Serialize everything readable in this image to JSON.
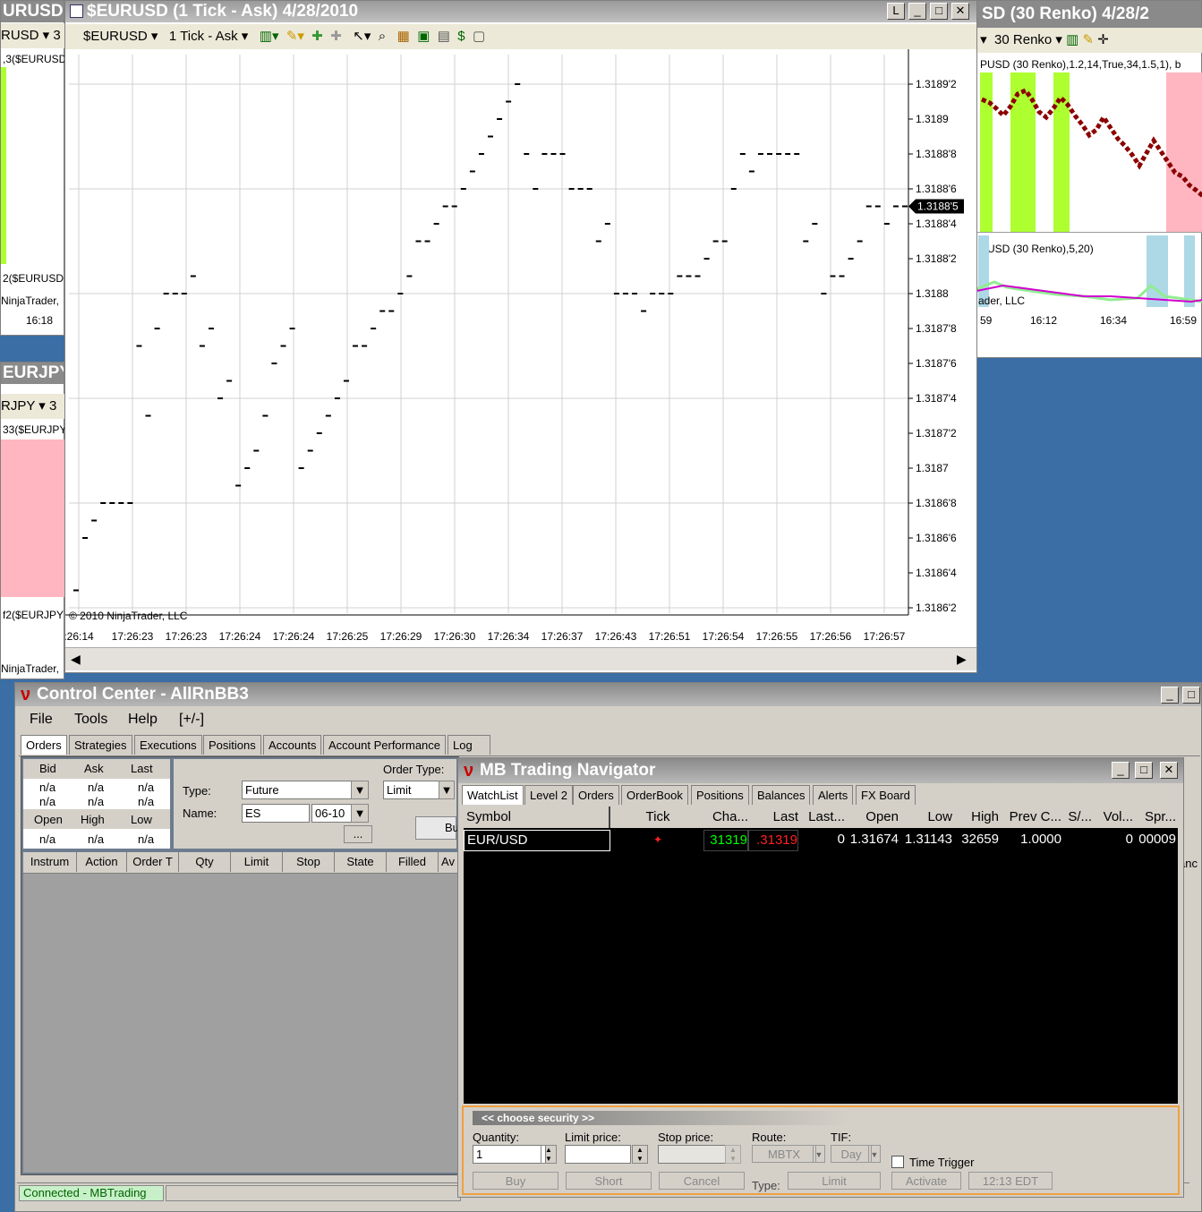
{
  "left_windows": {
    "top_title": "URUSD",
    "top_toolbar": "RUSD",
    "top_toolbar_right": "3",
    "top_indicator": ",3($EURUSD",
    "top_indicator2": "2($EURUSD",
    "top_footer": "NinjaTrader,",
    "top_time": "16:18",
    "bottom_title": "EURJPY",
    "bottom_toolbar": "RJPY",
    "bottom_toolbar_right": "3",
    "bottom_indicator": "33($EURJPY",
    "bottom_indicator2": "f2($EURJPY",
    "bottom_footer": "NinjaTrader,"
  },
  "renko_window": {
    "title": "SD (30 Renko)  4/28/2",
    "toolbar_label": "30 Renko",
    "indicator_label": "PUSD  (30  Renko),1.2,14,True,34,1.5,1),",
    "indicator_suffix": "b",
    "indicator2_label": "PUSD  (30 Renko),5,20)",
    "footer": "ader, LLC",
    "times": [
      "59",
      "16:12",
      "16:34",
      "16:59"
    ]
  },
  "tick_chart": {
    "title": "$EURUSD (1 Tick - Ask)  4/28/2010",
    "toolbar": {
      "instrument": "$EURUSD",
      "period": "1 Tick - Ask"
    },
    "copyright": "© 2010 NinjaTrader, LLC",
    "current_price": "1.3188'5",
    "chart_data": {
      "type": "scatter",
      "xlabel": "",
      "ylabel": "",
      "x_ticks": [
        ":26:14",
        "17:26:23",
        "17:26:23",
        "17:26:24",
        "17:26:24",
        "17:26:25",
        "17:26:29",
        "17:26:30",
        "17:26:34",
        "17:26:37",
        "17:26:43",
        "17:26:51",
        "17:26:54",
        "17:26:55",
        "17:26:56",
        "17:26:57"
      ],
      "y_ticks": [
        "1.3189'2",
        "1.3189",
        "1.3188'8",
        "1.3188'6",
        "1.3188'4",
        "1.3188'2",
        "1.3188",
        "1.3187'8",
        "1.3187'6",
        "1.3187'4",
        "1.3187'2",
        "1.3187",
        "1.3186'8",
        "1.3186'6",
        "1.3186'4",
        "1.3186'2"
      ],
      "ylim": [
        1.31862,
        1.31892
      ],
      "values": [
        1.31863,
        1.31866,
        1.31867,
        1.31868,
        1.31868,
        1.31868,
        1.31868,
        1.31877,
        1.31873,
        1.31878,
        1.3188,
        1.3188,
        1.3188,
        1.31881,
        1.31877,
        1.31878,
        1.31874,
        1.31875,
        1.31869,
        1.3187,
        1.31871,
        1.31873,
        1.31876,
        1.31877,
        1.31878,
        1.3187,
        1.31871,
        1.31872,
        1.31873,
        1.31874,
        1.31875,
        1.31877,
        1.31877,
        1.31878,
        1.31879,
        1.31879,
        1.3188,
        1.31881,
        1.31883,
        1.31883,
        1.31884,
        1.31885,
        1.31885,
        1.31886,
        1.31887,
        1.31888,
        1.31889,
        1.3189,
        1.31891,
        1.31892,
        1.31888,
        1.31886,
        1.31888,
        1.31888,
        1.31888,
        1.31886,
        1.31886,
        1.31886,
        1.31883,
        1.31884,
        1.3188,
        1.3188,
        1.3188,
        1.31879,
        1.3188,
        1.3188,
        1.3188,
        1.31881,
        1.31881,
        1.31881,
        1.31882,
        1.31883,
        1.31883,
        1.31886,
        1.31888,
        1.31887,
        1.31888,
        1.31888,
        1.31888,
        1.31888,
        1.31888,
        1.31883,
        1.31884,
        1.3188,
        1.31881,
        1.31881,
        1.31882,
        1.31883,
        1.31885,
        1.31885,
        1.31884,
        1.31885,
        1.31885
      ]
    }
  },
  "control_center": {
    "title": "Control Center - AllRnBB3",
    "menu": [
      "File",
      "Tools",
      "Help",
      "[+/-]"
    ],
    "tabs": [
      "Orders",
      "Strategies",
      "Executions",
      "Positions",
      "Accounts",
      "Account Performance",
      "Log"
    ],
    "quote_headers": [
      "Bid",
      "Ask",
      "Last"
    ],
    "quote_row1": [
      "n/a",
      "n/a",
      "n/a"
    ],
    "quote_row2": [
      "n/a",
      "n/a",
      "n/a"
    ],
    "quote_headers2": [
      "Open",
      "High",
      "Low"
    ],
    "quote_row3": [
      "n/a",
      "n/a",
      "n/a"
    ],
    "type_label": "Type:",
    "type_value": "Future",
    "name_label": "Name:",
    "name_value": "ES",
    "expiry_value": "06-10",
    "order_type_label": "Order Type:",
    "order_type_value": "Limit",
    "buy_partial": "Bu",
    "ellipsis": "...",
    "grid_headers": [
      "Instrum",
      "Action",
      "Order T",
      "Qty",
      "Limit",
      "Stop",
      "State",
      "Filled",
      "Av"
    ],
    "status": "Connected - MBTrading",
    "edge_text": "anc"
  },
  "navigator": {
    "title": "MB Trading Navigator",
    "tabs": [
      "WatchList",
      "Level 2",
      "Orders",
      "OrderBook",
      "Positions",
      "Balances",
      "Alerts",
      "FX Board"
    ],
    "headers": [
      "Symbol",
      "Tick",
      "Cha...",
      "Last",
      "Last...",
      "Open",
      "Low",
      "High",
      "Prev C...",
      "S/...",
      "Vol...",
      "Spr..."
    ],
    "row": {
      "symbol": "EUR/USD",
      "change": "31319",
      "last": ".31319",
      "last_size": "0",
      "open": "1.31674",
      "low": "1.31143",
      "high": "32659",
      "prev_close": "1.0000",
      "s": "",
      "volume": "0",
      "spread": "00009"
    },
    "order_panel": {
      "choose": "<< choose security >>",
      "quantity_label": "Quantity:",
      "quantity_value": "1",
      "limit_label": "Limit price:",
      "limit_value": "",
      "stop_label": "Stop price:",
      "stop_value": "",
      "route_label": "Route:",
      "route_value": "MBTX",
      "tif_label": "TIF:",
      "tif_value": "Day",
      "time_trigger": "Time Trigger",
      "buy": "Buy",
      "short": "Short",
      "cancel": "Cancel",
      "type_label": "Type:",
      "type_value": "Limit",
      "activate": "Activate",
      "time_value": "12:13  EDT"
    }
  },
  "colors": {
    "desktop": "#3a6ea5",
    "titlebar": "#a0a0a0",
    "renko_green": "#adff2f",
    "renko_pink": "#ffb6c1",
    "nav_bg": "#000000",
    "change_green": "#00ff00",
    "last_red": "#ff0000",
    "orange": "#f0a040"
  }
}
